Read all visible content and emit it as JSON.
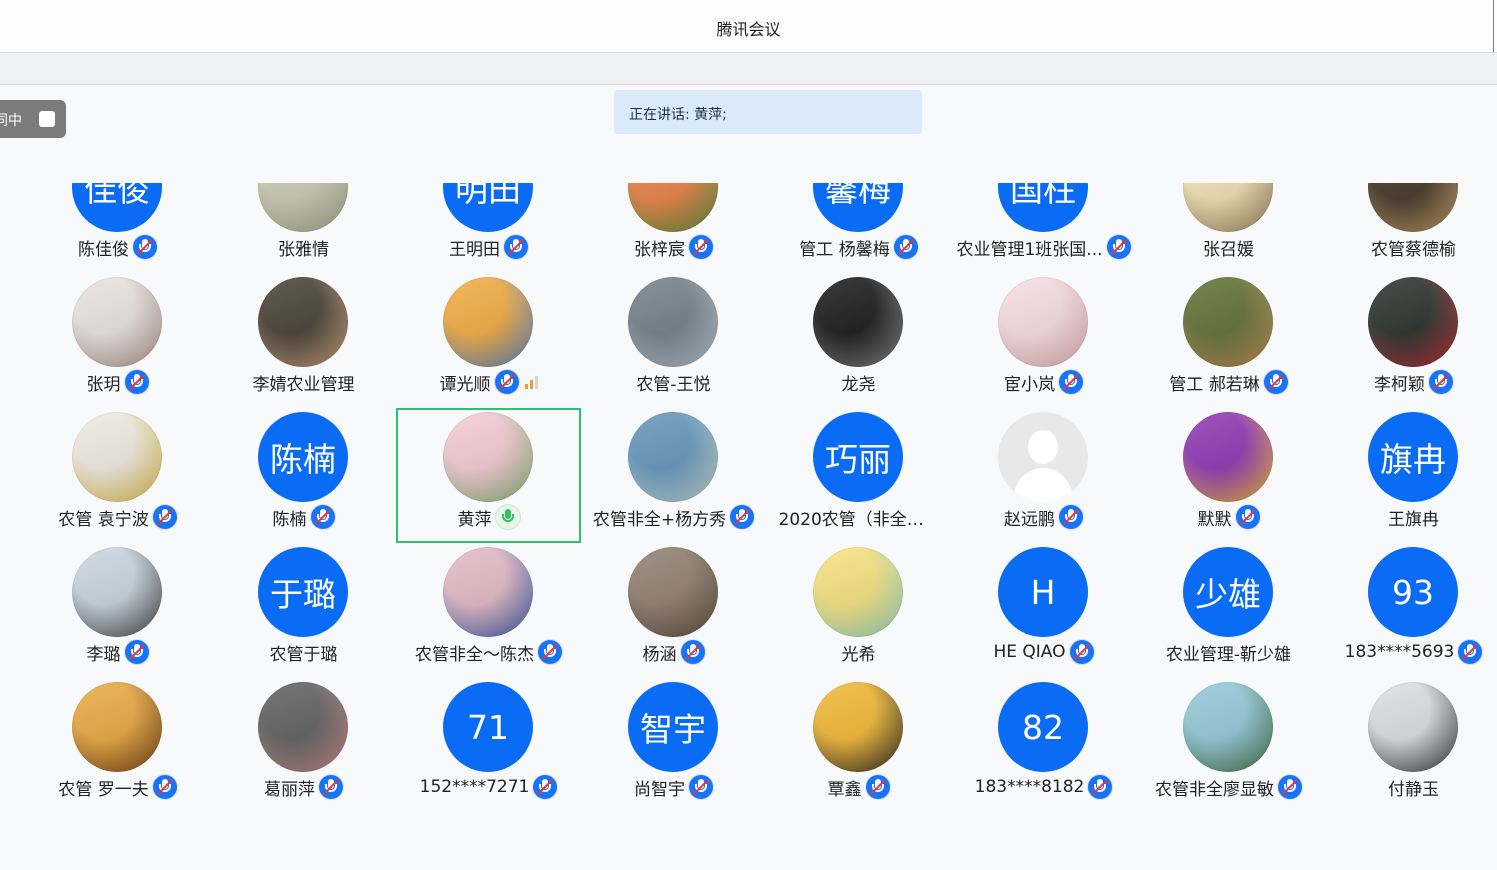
{
  "window": {
    "title": "腾讯会议"
  },
  "toggle": {
    "label": "同中"
  },
  "speaking_banner": {
    "text": "正在讲话: 黄萍;"
  },
  "colors": {
    "avatar_text_bg": "#0a6cf5",
    "mic_icon": "#1a73f5",
    "active_border": "#2fbf71",
    "banner_bg": "#dbe9fb"
  },
  "participants": [
    {
      "name": "陈佳俊",
      "avatar": {
        "kind": "text",
        "text": "佳俊"
      },
      "mic": "muted"
    },
    {
      "name": "张雅情",
      "avatar": {
        "kind": "photo",
        "palette": [
          "#c9c7b2",
          "#9aa082"
        ]
      },
      "mic": "none"
    },
    {
      "name": "王明田",
      "avatar": {
        "kind": "text",
        "text": "明田"
      },
      "mic": "muted"
    },
    {
      "name": "张梓宸",
      "avatar": {
        "kind": "photo",
        "palette": [
          "#e97b3d",
          "#4f8d3d"
        ]
      },
      "mic": "muted"
    },
    {
      "name": "管工 杨馨梅",
      "avatar": {
        "kind": "text",
        "text": "馨梅"
      },
      "mic": "muted"
    },
    {
      "name": "农业管理1班张国...",
      "avatar": {
        "kind": "text",
        "text": "国柱"
      },
      "mic": "muted"
    },
    {
      "name": "张召媛",
      "avatar": {
        "kind": "photo",
        "palette": [
          "#f0dfae",
          "#8f7a55"
        ]
      },
      "mic": "none"
    },
    {
      "name": "农管蔡德榆",
      "avatar": {
        "kind": "photo",
        "palette": [
          "#3c2f1f",
          "#c9a36a"
        ]
      },
      "mic": "none"
    },
    {
      "name": "张玥",
      "avatar": {
        "kind": "photo",
        "palette": [
          "#e8e2dd",
          "#a58b82"
        ]
      },
      "mic": "muted"
    },
    {
      "name": "李婧农业管理",
      "avatar": {
        "kind": "photo",
        "palette": [
          "#3f3a2b",
          "#d1a486"
        ]
      },
      "mic": "none"
    },
    {
      "name": "谭光顺",
      "avatar": {
        "kind": "photo",
        "palette": [
          "#f1a83a",
          "#4f7fc4"
        ]
      },
      "mic": "muted",
      "signal": true
    },
    {
      "name": "农管-王悦",
      "avatar": {
        "kind": "photo",
        "palette": [
          "#6d7a86",
          "#b9c4cc"
        ]
      },
      "mic": "none"
    },
    {
      "name": "龙尧",
      "avatar": {
        "kind": "photo",
        "palette": [
          "#111111",
          "#8a8a8a"
        ]
      },
      "mic": "none"
    },
    {
      "name": "宦小岚",
      "avatar": {
        "kind": "photo",
        "palette": [
          "#f5dde0",
          "#d9a8ab"
        ]
      },
      "mic": "muted"
    },
    {
      "name": "管工 郝若琳",
      "avatar": {
        "kind": "photo",
        "palette": [
          "#5b6b2d",
          "#c28c58"
        ]
      },
      "mic": "muted"
    },
    {
      "name": "李柯颖",
      "avatar": {
        "kind": "photo",
        "palette": [
          "#1f2a24",
          "#c0303a"
        ]
      },
      "mic": "muted"
    },
    {
      "name": "农管 袁宁波",
      "avatar": {
        "kind": "photo",
        "palette": [
          "#efe9df",
          "#d8b73f"
        ]
      },
      "mic": "muted"
    },
    {
      "name": "陈楠",
      "avatar": {
        "kind": "text",
        "text": "陈楠"
      },
      "mic": "muted"
    },
    {
      "name": "黄萍",
      "avatar": {
        "kind": "photo",
        "palette": [
          "#f4c8d3",
          "#7fae6a"
        ]
      },
      "mic": "live",
      "active": true
    },
    {
      "name": "农管非全+杨方秀",
      "avatar": {
        "kind": "photo",
        "palette": [
          "#5d92b8",
          "#c7d6cf"
        ]
      },
      "mic": "muted"
    },
    {
      "name": "2020农管（非全）...",
      "avatar": {
        "kind": "text",
        "text": "巧丽"
      },
      "mic": "none"
    },
    {
      "name": "赵远鹏",
      "avatar": {
        "kind": "default"
      },
      "mic": "muted"
    },
    {
      "name": "默默",
      "avatar": {
        "kind": "photo",
        "palette": [
          "#8a2fb0",
          "#f1c232"
        ]
      },
      "mic": "muted"
    },
    {
      "name": "王旗冉",
      "avatar": {
        "kind": "text",
        "text": "旗冉"
      },
      "mic": "none"
    },
    {
      "name": "李璐",
      "avatar": {
        "kind": "photo",
        "palette": [
          "#c6d3df",
          "#3b3b3b"
        ]
      },
      "mic": "muted"
    },
    {
      "name": "农管于璐",
      "avatar": {
        "kind": "text",
        "text": "于璐"
      },
      "mic": "none"
    },
    {
      "name": "农管非全～陈杰",
      "avatar": {
        "kind": "photo",
        "palette": [
          "#e2b7c2",
          "#3453a5"
        ]
      },
      "mic": "muted"
    },
    {
      "name": "杨涵",
      "avatar": {
        "kind": "photo",
        "palette": [
          "#8b7a6a",
          "#5a4a3c"
        ]
      },
      "mic": "muted"
    },
    {
      "name": "光希",
      "avatar": {
        "kind": "photo",
        "palette": [
          "#f6e17a",
          "#8ed0c0"
        ]
      },
      "mic": "none"
    },
    {
      "name": "HE QIAO",
      "avatar": {
        "kind": "text",
        "text": "H"
      },
      "mic": "muted"
    },
    {
      "name": "农业管理-靳少雄",
      "avatar": {
        "kind": "text",
        "text": "少雄"
      },
      "mic": "none"
    },
    {
      "name": "183****5693",
      "avatar": {
        "kind": "text",
        "text": "93"
      },
      "mic": "muted"
    },
    {
      "name": "农管 罗一夫",
      "avatar": {
        "kind": "photo",
        "palette": [
          "#e8a53a",
          "#6b3a12"
        ]
      },
      "mic": "muted"
    },
    {
      "name": "葛丽萍",
      "avatar": {
        "kind": "photo",
        "palette": [
          "#5a5a5a",
          "#c98b8b"
        ]
      },
      "mic": "muted"
    },
    {
      "name": "152****7271",
      "avatar": {
        "kind": "text",
        "text": "71"
      },
      "mic": "muted"
    },
    {
      "name": "尚智宇",
      "avatar": {
        "kind": "text",
        "text": "智宇"
      },
      "mic": "muted"
    },
    {
      "name": "覃鑫",
      "avatar": {
        "kind": "photo",
        "palette": [
          "#f1b52e",
          "#222222"
        ]
      },
      "mic": "muted"
    },
    {
      "name": "183****8182",
      "avatar": {
        "kind": "text",
        "text": "82"
      },
      "mic": "muted"
    },
    {
      "name": "农管非全廖显敏",
      "avatar": {
        "kind": "photo",
        "palette": [
          "#8fc6d8",
          "#3f6a3a"
        ]
      },
      "mic": "muted"
    },
    {
      "name": "付静玉",
      "avatar": {
        "kind": "photo",
        "palette": [
          "#d8dde0",
          "#2d2d2d"
        ]
      },
      "mic": "none"
    }
  ]
}
